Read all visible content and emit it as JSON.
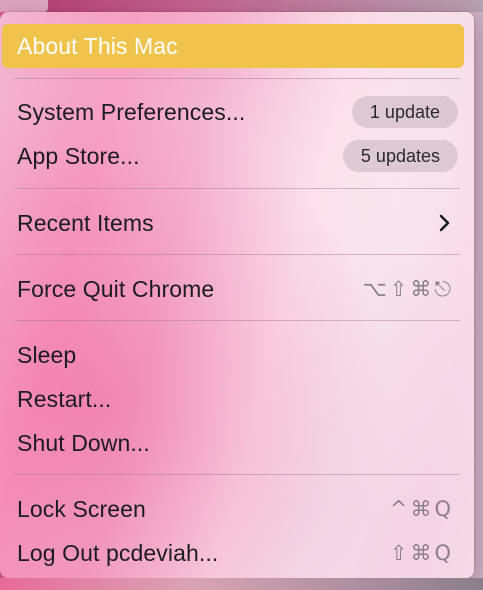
{
  "menu": {
    "about": {
      "label": "About This Mac"
    },
    "system_preferences": {
      "label": "System Preferences...",
      "badge": "1 update"
    },
    "app_store": {
      "label": "App Store...",
      "badge": "5 updates"
    },
    "recent_items": {
      "label": "Recent Items"
    },
    "force_quit": {
      "label": "Force Quit Chrome",
      "shortcut": "⌥⇧⌘⎋"
    },
    "sleep": {
      "label": "Sleep"
    },
    "restart": {
      "label": "Restart..."
    },
    "shut_down": {
      "label": "Shut Down..."
    },
    "lock_screen": {
      "label": "Lock Screen",
      "shortcut": "^⌘Q"
    },
    "log_out": {
      "label": "Log Out pcdeviah...",
      "shortcut": "⇧⌘Q"
    }
  },
  "colors": {
    "highlight": "#f0c44c",
    "badge_bg": "#d8c2cc"
  }
}
